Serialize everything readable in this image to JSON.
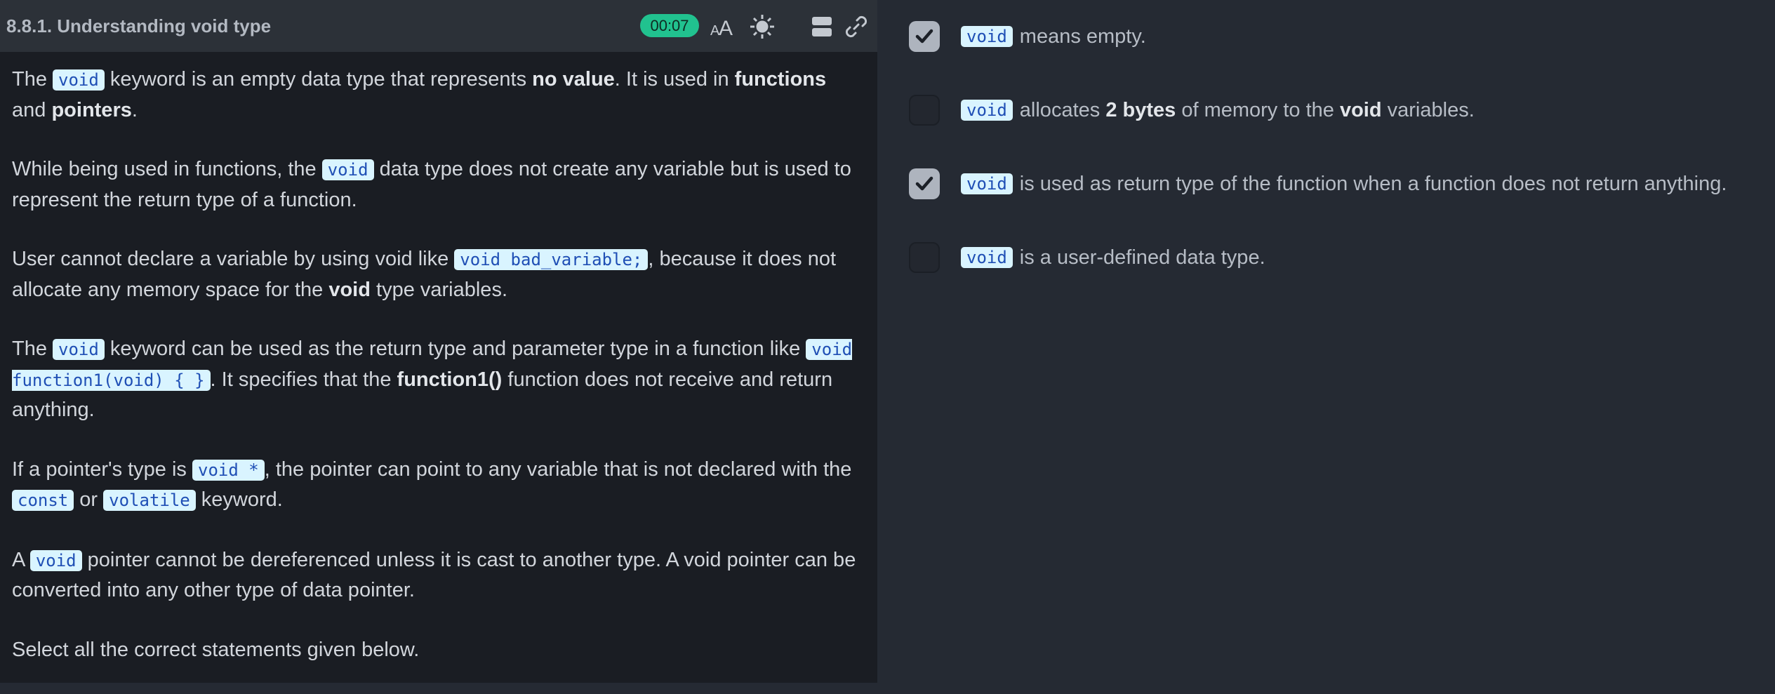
{
  "header": {
    "title": "8.8.1. Understanding void type",
    "timer": "00:07",
    "font_size_icon": "font-size-icon",
    "theme_icon": "sun-icon",
    "layout_icon": "split-layout-icon",
    "link_icon": "link-icon"
  },
  "content": {
    "p1": {
      "t1": "The ",
      "code1": "void",
      "t2": " keyword is an empty data type that represents ",
      "b1": "no value",
      "t3": ". It is used in ",
      "b2": "functions",
      "t4": " and ",
      "b3": "pointers",
      "t5": "."
    },
    "p2": {
      "t1": "While being used in functions, the ",
      "code1": "void",
      "t2": " data type does not create any variable but is used to represent the return type of a function."
    },
    "p3": {
      "t1": "User cannot declare a variable by using void like ",
      "code1": "void bad_variable;",
      "t2": ", because it does not allocate any memory space for the ",
      "b1": "void",
      "t3": " type variables."
    },
    "p4": {
      "t1": "The ",
      "code1": "void",
      "t2": " keyword can be used as the return type and parameter type in a function like ",
      "code2": "void function1(void) { }",
      "t3": ". It specifies that the ",
      "b1": "function1()",
      "t4": " function does not receive and return anything."
    },
    "p5": {
      "t1": "If a pointer's type is ",
      "code1": "void *",
      "t2": ", the pointer can point to any variable that is not declared with the ",
      "code2": "const",
      "t3": " or ",
      "code3": "volatile",
      "t4": " keyword."
    },
    "p6": {
      "t1": "A ",
      "code1": "void",
      "t2": " pointer cannot be dereferenced unless it is cast to another type. A void pointer can be converted into any other type of data pointer."
    },
    "p7": {
      "t1": "Select all the correct statements given below."
    }
  },
  "options": [
    {
      "checked": true,
      "code": "void",
      "t1": "means empty."
    },
    {
      "checked": false,
      "code": "void",
      "t1": "allocates ",
      "b1": "2 bytes",
      "t2": " of memory to the ",
      "b2": "void",
      "t3": " variables."
    },
    {
      "checked": true,
      "code": "void",
      "t1": "is used as return type of the function when a function does not return anything."
    },
    {
      "checked": false,
      "code": "void",
      "t1": "is a user-defined data type."
    }
  ],
  "colors": {
    "accent_timer": "#21c28f",
    "code_bg": "#d9f4ff",
    "code_fg": "#1f4fb5"
  }
}
